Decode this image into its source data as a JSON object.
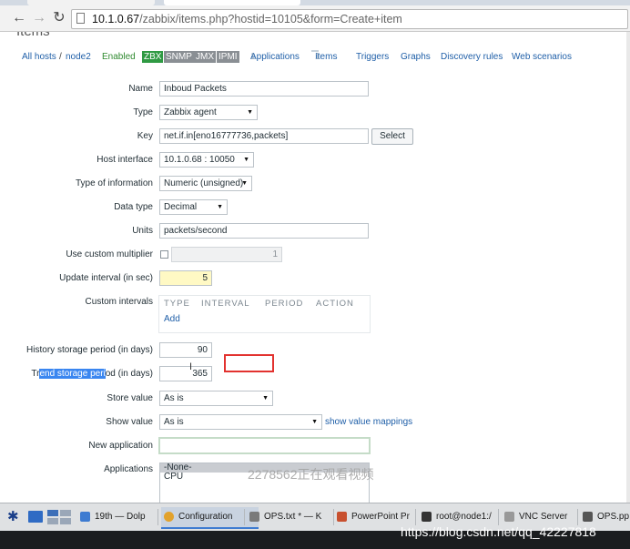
{
  "browser": {
    "url_host": "10.1.0.67",
    "url_path": "/zabbix/items.php?hostid=10105&form=Create+item"
  },
  "page": {
    "title": "Items",
    "breadcrumb": {
      "all_hosts": "All hosts",
      "separator": "/",
      "host": "node2",
      "status": "Enabled"
    },
    "availability": [
      "ZBX",
      "SNMP",
      "JMX",
      "IPMI"
    ],
    "tabs": [
      {
        "label": "Applications",
        "count": "1"
      },
      {
        "label": "Items",
        "count": "1"
      },
      {
        "label": "Triggers"
      },
      {
        "label": "Graphs"
      },
      {
        "label": "Discovery rules"
      },
      {
        "label": "Web scenarios"
      }
    ]
  },
  "form": {
    "name": {
      "label": "Name",
      "value": "Inboud Packets"
    },
    "type": {
      "label": "Type",
      "value": "Zabbix agent"
    },
    "key": {
      "label": "Key",
      "value": "net.if.in[eno16777736,packets]",
      "button": "Select"
    },
    "host_interface": {
      "label": "Host interface",
      "value": "10.1.0.68 : 10050"
    },
    "type_of_information": {
      "label": "Type of information",
      "value": "Numeric (unsigned)"
    },
    "data_type": {
      "label": "Data type",
      "value": "Decimal"
    },
    "units": {
      "label": "Units",
      "value": "packets/second"
    },
    "custom_multiplier": {
      "label": "Use custom multiplier",
      "value": "1"
    },
    "update_interval": {
      "label": "Update interval (in sec)",
      "value": "5"
    },
    "custom_intervals": {
      "label": "Custom intervals",
      "columns": [
        "TYPE",
        "INTERVAL",
        "PERIOD",
        "ACTION"
      ],
      "add": "Add"
    },
    "history": {
      "label": "History storage period (in days)",
      "value": "90"
    },
    "trends": {
      "label_pre": "Tr",
      "label_selected": "end storage peri",
      "label_post": "od (in days)",
      "value": "365"
    },
    "store_value": {
      "label": "Store value",
      "value": "As is"
    },
    "show_value": {
      "label": "Show value",
      "value": "As is",
      "link": "show value mappings"
    },
    "new_application": {
      "label": "New application",
      "value": ""
    },
    "applications": {
      "label": "Applications",
      "options": [
        "-None-",
        "CPU"
      ]
    }
  },
  "overlay": {
    "watermark_viewer": "2278562正在观看视频",
    "watermark_blog": "https://blog.csdn.net/qq_42227818"
  },
  "taskbar": {
    "items": [
      {
        "label": "19th — Dolp",
        "color": "#3d7bd1"
      },
      {
        "label": "Configuration",
        "color": "#e2a22d"
      },
      {
        "label": "OPS.txt * — K",
        "color": "#7a7a7a"
      },
      {
        "label": "PowerPoint Pr",
        "color": "#c8502f"
      },
      {
        "label": "root@node1:/",
        "color": "#333333"
      },
      {
        "label": "VNC Server",
        "color": "#999999"
      },
      {
        "label": "OPS.pp",
        "color": "#555555"
      }
    ]
  }
}
